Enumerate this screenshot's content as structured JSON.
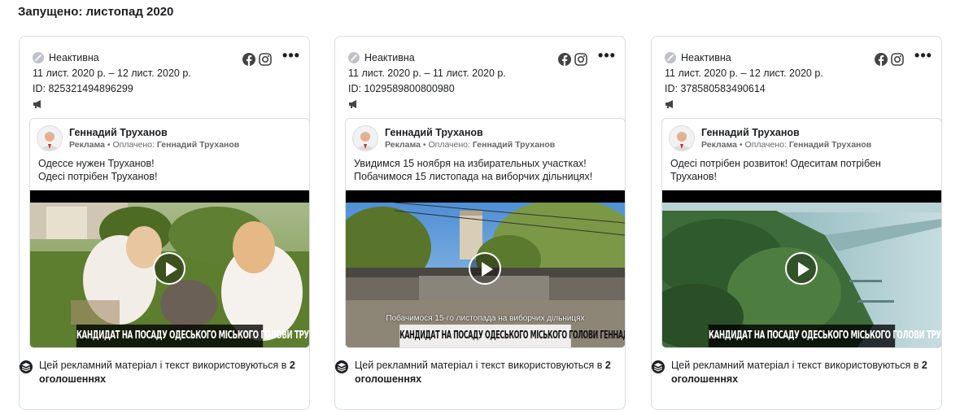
{
  "section": {
    "title": "Запущено: листопад 2020"
  },
  "colors": {
    "text": "#1c1e21",
    "secondary": "#65676b",
    "border": "#dadde1",
    "facebook": "#1c1e21"
  },
  "cards": [
    {
      "status": "Неактивна",
      "dates": "11 лист. 2020 р. – 12 лист. 2020 р.",
      "id": "ID: 825321494896299",
      "page_name": "Геннадий Труханов",
      "sponsor_label": "Реклама",
      "sponsor_paid": " • Оплачено: ",
      "sponsor_name": "Геннадий Труханов",
      "text_lines": [
        "Одессе нужен Труханов!",
        "Одесі потрібен Труханов!"
      ],
      "video_caption": "КАНДИДАТ НА ПОСАДУ ОДЕСЬКОГО МІСЬКОГО ГОЛОВИ ТРУХАНОВ Г.Л.",
      "video_subtitle": "",
      "footer_text": "Цей рекламний матеріал і текст використовуються в ",
      "footer_count": "2 оголошеннях"
    },
    {
      "status": "Неактивна",
      "dates": "11 лист. 2020 р. – 11 лист. 2020 р.",
      "id": "ID: 1029589800800980",
      "page_name": "Геннадий Труханов",
      "sponsor_label": "Реклама",
      "sponsor_paid": " • Оплачено: ",
      "sponsor_name": "Геннадий Труханов",
      "text_lines": [
        "Увидимся 15 ноября на избирательных участках!",
        "Побачимося 15 листопада на виборчих дільницях!"
      ],
      "video_caption": "КАНДИДАТ НА ПОСАДУ ОДЕСЬКОГО МІСЬКОГО ГОЛОВИ ГЕННАДІЙ ТРУХАНОВ",
      "video_subtitle": "Побачимося 15-го листопада на виборчих дільницях",
      "footer_text": "Цей рекламний матеріал і текст використовуються в ",
      "footer_count": "2 оголошеннях"
    },
    {
      "status": "Неактивна",
      "dates": "11 лист. 2020 р. – 12 лист. 2020 р.",
      "id": "ID: 378580583490614",
      "page_name": "Геннадий Труханов",
      "sponsor_label": "Реклама",
      "sponsor_paid": " • Оплачено: ",
      "sponsor_name": "Геннадий Труханов",
      "text_lines": [
        "Одесі потрібен розвиток! Одеситам потрібен",
        "Труханов!"
      ],
      "video_caption": "КАНДИДАТ НА ПОСАДУ ОДЕСЬКОГО МІСЬКОГО ГОЛОВИ ТРУХАНОВ Г.Л.",
      "video_subtitle": "",
      "footer_text": "Цей рекламний матеріал і текст використовуються в ",
      "footer_count": "2 оголошеннях"
    }
  ],
  "icons": {
    "status": "inactive-status-icon",
    "facebook": "facebook-icon",
    "instagram": "instagram-icon",
    "more": "more-options-icon",
    "megaphone": "megaphone-icon",
    "play": "play-icon",
    "layers": "layers-icon"
  }
}
